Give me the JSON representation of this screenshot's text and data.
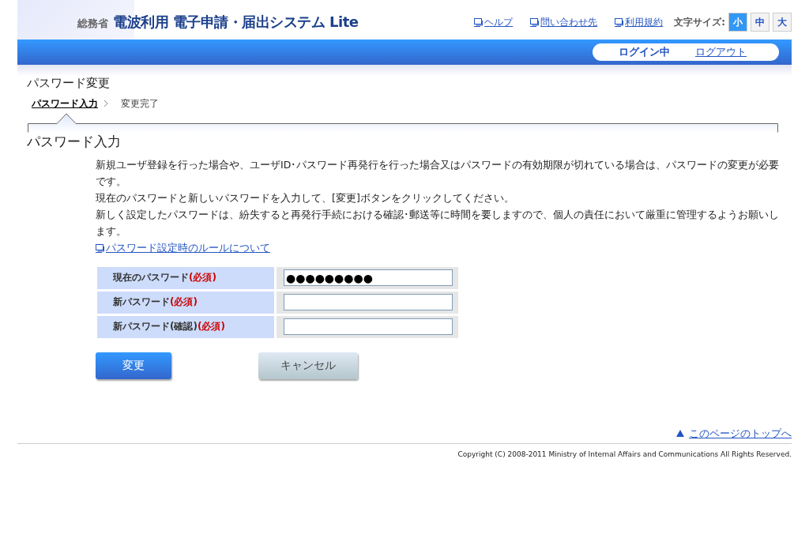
{
  "header": {
    "ministry": "総務省",
    "title": "電波利用 電子申請・届出システム Lite",
    "links": [
      "ヘルプ",
      "問い合わせ先",
      "利用規約"
    ],
    "font_size_label": "文字サイズ:",
    "font_sizes": [
      {
        "label": "小",
        "selected": true
      },
      {
        "label": "中",
        "selected": false
      },
      {
        "label": "大",
        "selected": false
      }
    ]
  },
  "login_bar": {
    "status": "ログイン中",
    "logout": "ログアウト"
  },
  "page_title": "パスワード変更",
  "steps": [
    {
      "label": "パスワード入力",
      "selected": true
    },
    {
      "label": "変更完了",
      "selected": false
    }
  ],
  "section_title": "パスワード入力",
  "paragraphs": [
    "新規ユーザ登録を行った場合や、ユーザID･パスワード再発行を行った場合又はパスワードの有効期限が切れている場合は、パスワードの変更が必要です。",
    "現在のパスワードと新しいパスワードを入力して、[変更]ボタンをクリックしてください。",
    "新しく設定したパスワードは、紛失すると再発行手続における確認･郵送等に時間を要しますので、個人の責任において厳重に管理するようお願いします。"
  ],
  "rules_link": "パスワード設定時のルールについて",
  "form": [
    {
      "label": "現在のパスワード",
      "required": "(必須)",
      "value": "●●●●●●●●●"
    },
    {
      "label": "新パスワード",
      "required": "(必須)"
    },
    {
      "label": "新パスワード(確認)",
      "required": "(必須)"
    }
  ],
  "buttons": [
    {
      "label": "変更",
      "kind": "primary"
    },
    {
      "label": "キャンセル",
      "kind": "secondary"
    }
  ],
  "page_top_link": "このページのトップへ",
  "copyright": "Copyright (C) 2008-2011 Ministry of Internal Affairs and Communications All Rights Reserved."
}
